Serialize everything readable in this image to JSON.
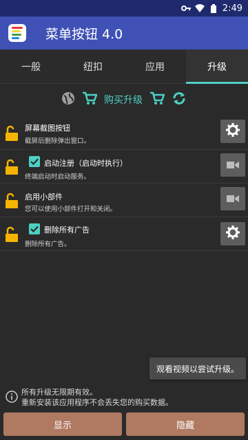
{
  "status_bar": {
    "time": "2:49"
  },
  "app": {
    "title": "菜单按钮 4.0"
  },
  "tabs": [
    {
      "label": "一般"
    },
    {
      "label": "纽扣"
    },
    {
      "label": "应用"
    },
    {
      "label": "升级"
    }
  ],
  "buy": {
    "label": "购买升级"
  },
  "settings": [
    {
      "title": "屏幕截图按钮",
      "desc": "截屏后删除弹出窗口。",
      "checked": false,
      "side_icon": "gear-icon"
    },
    {
      "title": "启动注册（启动时执行）",
      "desc": "终端启动时启动服务。",
      "checked": true,
      "side_icon": "video-camera-icon"
    },
    {
      "title": "启用小部件",
      "desc": "您可以使用小部件打开和关闭。",
      "checked": false,
      "side_icon": "video-camera-icon"
    },
    {
      "title": "删除所有广告",
      "desc": "删除所有广告。",
      "checked": true,
      "side_icon": "gear-icon"
    }
  ],
  "tooltip": {
    "text": "观看视频以尝试升级。"
  },
  "info": {
    "line1": "所有升级无限期有效。",
    "line2": "重新安装该应用程序不会丢失您的购买数据。"
  },
  "buttons": {
    "show": "显示",
    "hide": "隐藏"
  },
  "colors": {
    "accent": "#4dd0c4",
    "app_bar": "#3f51b5",
    "status_bar": "#1f2a6e",
    "lock": "#f5b400",
    "button": "#b07a62"
  }
}
